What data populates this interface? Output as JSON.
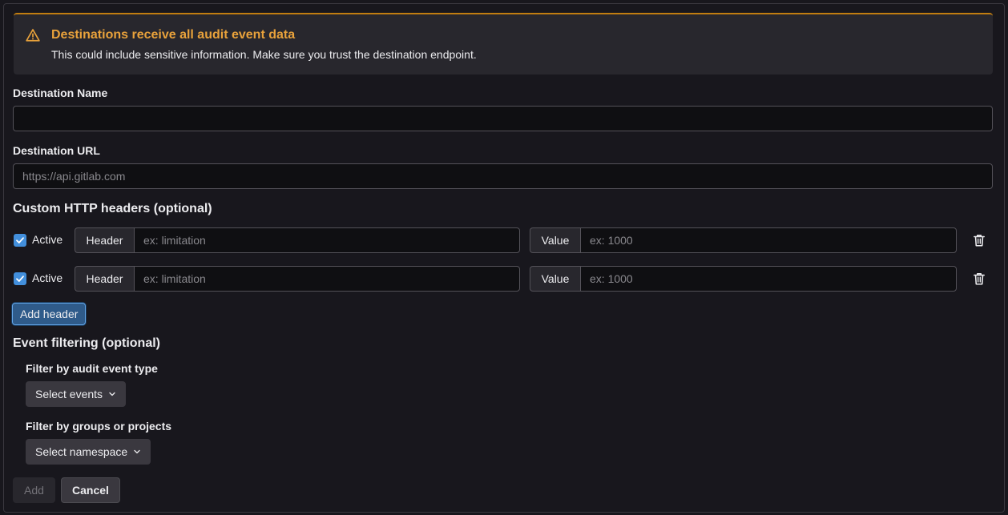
{
  "alert": {
    "title": "Destinations receive all audit event data",
    "body": "This could include sensitive information. Make sure you trust the destination endpoint.",
    "icon": "warning-icon",
    "accent": "#e9a23b"
  },
  "form": {
    "name_label": "Destination Name",
    "name_value": "",
    "name_placeholder": "",
    "url_label": "Destination URL",
    "url_value": "",
    "url_placeholder": "https://api.gitlab.com"
  },
  "headers": {
    "title": "Custom HTTP headers (optional)",
    "rows": [
      {
        "active": true,
        "active_label": "Active",
        "header_label": "Header",
        "header_placeholder": "ex: limitation",
        "value_label": "Value",
        "value_placeholder": "ex: 1000"
      },
      {
        "active": true,
        "active_label": "Active",
        "header_label": "Header",
        "header_placeholder": "ex: limitation",
        "value_label": "Value",
        "value_placeholder": "ex: 1000"
      }
    ],
    "add_label": "Add header"
  },
  "filtering": {
    "title": "Event filtering (optional)",
    "type_label": "Filter by audit event type",
    "type_dropdown": "Select events",
    "ns_label": "Filter by groups or projects",
    "ns_dropdown": "Select namespace"
  },
  "actions": {
    "add_label": "Add",
    "cancel_label": "Cancel"
  },
  "colors": {
    "background": "#18171d",
    "primary": "#428fdc",
    "warning": "#e9a23b"
  }
}
